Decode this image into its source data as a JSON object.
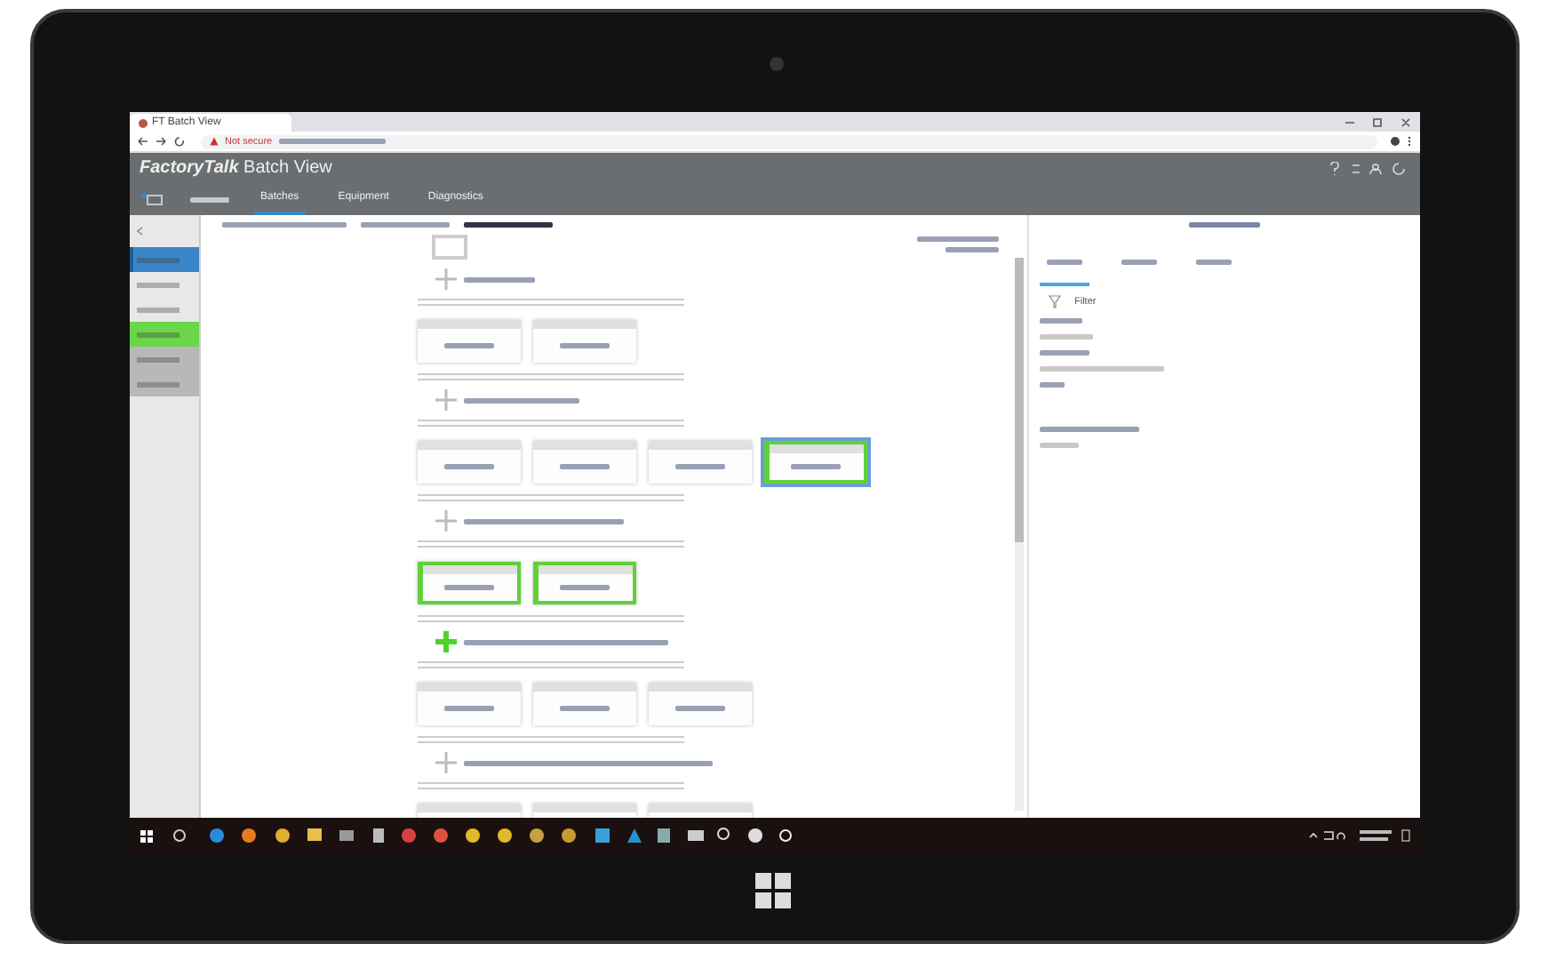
{
  "browser": {
    "tab_title": "FT Batch View",
    "security": "Not secure"
  },
  "app": {
    "brand": "FactoryTalk",
    "product": "Batch View"
  },
  "nav": [
    {
      "label": "Batches",
      "selected": true
    },
    {
      "label": "Equipment",
      "selected": false
    },
    {
      "label": "Diagnostics",
      "selected": false
    }
  ],
  "sidebar": [
    {
      "selected": true,
      "color": "#3a86c8"
    },
    {
      "selected": false,
      "color": "#e8e8e8"
    },
    {
      "selected": false,
      "color": "#e8e8e8"
    },
    {
      "selected": false,
      "color": "#6cd64a"
    },
    {
      "selected": false,
      "color": "#b8b8b8"
    },
    {
      "selected": false,
      "color": "#b8b8b8"
    }
  ],
  "chart": [
    {
      "active": false,
      "steps": [
        {
          "active": false,
          "selected": false
        },
        {
          "active": false,
          "selected": false
        }
      ]
    },
    {
      "active": false,
      "steps": [
        {
          "active": false,
          "selected": false
        },
        {
          "active": false,
          "selected": false
        },
        {
          "active": false,
          "selected": false
        },
        {
          "active": true,
          "selected": true
        }
      ]
    },
    {
      "active": false,
      "steps": [
        {
          "active": true,
          "selected": false
        },
        {
          "active": true,
          "selected": false
        }
      ]
    },
    {
      "active": true,
      "steps": [
        {
          "active": false,
          "selected": false
        },
        {
          "active": false,
          "selected": false
        },
        {
          "active": false,
          "selected": false
        }
      ]
    },
    {
      "active": false,
      "steps": [
        {
          "active": false,
          "selected": false
        },
        {
          "active": false,
          "selected": false
        },
        {
          "active": false,
          "selected": false
        }
      ]
    }
  ],
  "details": {
    "tabs": [
      {
        "selected": true
      },
      {
        "selected": false
      },
      {
        "selected": false
      }
    ],
    "filter": "Filter"
  }
}
